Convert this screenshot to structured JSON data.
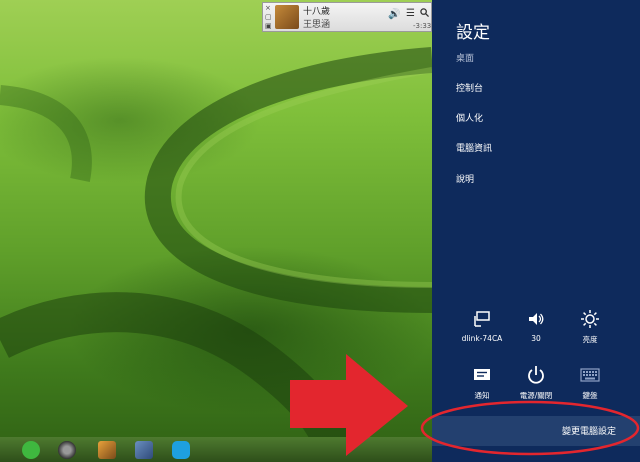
{
  "player": {
    "song_title": "十八歲",
    "artist": "王思涵",
    "time_remaining": "-3:33",
    "close_glyph": "×",
    "icons": [
      "speaker-icon",
      "list-icon",
      "search-icon"
    ]
  },
  "settings_panel": {
    "title": "設定",
    "menu": [
      {
        "label": "桌面",
        "dim": true
      },
      {
        "label": "控制台"
      },
      {
        "label": "個人化"
      },
      {
        "label": "電腦資訊"
      },
      {
        "label": "說明"
      }
    ],
    "quick_settings": [
      {
        "icon": "network-icon",
        "label": "dlink-74CA"
      },
      {
        "icon": "volume-icon",
        "label": "30"
      },
      {
        "icon": "brightness-icon",
        "label": "亮度"
      },
      {
        "icon": "notifications-icon",
        "label": "通知"
      },
      {
        "icon": "power-icon",
        "label": "電源/關閉"
      },
      {
        "icon": "keyboard-icon",
        "label": "鍵盤"
      }
    ],
    "change_pc_settings": "變更電腦設定",
    "colors": {
      "panel": "#0e2a5c",
      "bar": "#23406f"
    }
  },
  "taskbar": {
    "icons": [
      "line-icon",
      "speaker-app-icon",
      "paint-icon",
      "photo-icon",
      "skype-icon"
    ]
  },
  "annotation": {
    "arrow_color": "#e3262e",
    "ellipse_color": "#e3262e"
  }
}
